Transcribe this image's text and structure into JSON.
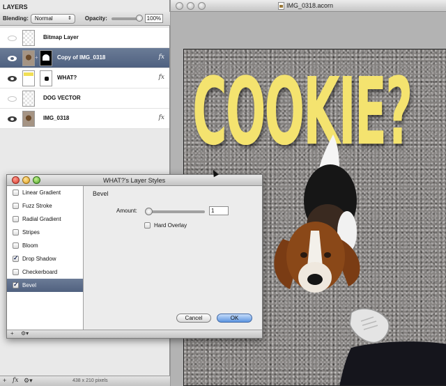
{
  "layers_panel": {
    "title": "LAYERS",
    "blending_label": "Blending:",
    "blending_value": "Normal",
    "opacity_label": "Opacity:",
    "opacity_value": "100%",
    "opacity_fraction": 1.0,
    "layers": [
      {
        "name": "Bitmap Layer",
        "visible": false,
        "selected": false,
        "fx": false
      },
      {
        "name": "Copy of IMG_0318",
        "visible": true,
        "selected": true,
        "fx": true
      },
      {
        "name": "WHAT?",
        "visible": true,
        "selected": false,
        "fx": true
      },
      {
        "name": "DOG VECTOR",
        "visible": false,
        "selected": false,
        "fx": false
      },
      {
        "name": "IMG_0318",
        "visible": true,
        "selected": false,
        "fx": true
      }
    ],
    "fx_label": "fx",
    "footer": {
      "add": "+",
      "fx": "fx",
      "gear": "⚙▾",
      "dimensions": "438 x 210 pixels"
    }
  },
  "document": {
    "title": "IMG_0318.acorn",
    "canvas_text": "COOKIE?"
  },
  "layer_styles": {
    "title": "WHAT?'s Layer Styles",
    "styles": [
      {
        "label": "Linear Gradient",
        "checked": false,
        "selected": false
      },
      {
        "label": "Fuzz Stroke",
        "checked": false,
        "selected": false
      },
      {
        "label": "Radial Gradient",
        "checked": false,
        "selected": false
      },
      {
        "label": "Stripes",
        "checked": false,
        "selected": false
      },
      {
        "label": "Bloom",
        "checked": false,
        "selected": false
      },
      {
        "label": "Drop Shadow",
        "checked": true,
        "selected": false
      },
      {
        "label": "Checkerboard",
        "checked": false,
        "selected": false
      },
      {
        "label": "Bevel",
        "checked": true,
        "selected": true
      }
    ],
    "pane_title": "Bevel",
    "amount_label": "Amount:",
    "amount_value": "1",
    "hard_overlay_label": "Hard Overlay",
    "cancel_label": "Cancel",
    "ok_label": "OK",
    "footer": {
      "add": "+",
      "gear": "⚙▾"
    }
  },
  "colors": {
    "selection": "#55647f",
    "headline": "#f4e36f",
    "ok_button": "#5d95e0"
  }
}
